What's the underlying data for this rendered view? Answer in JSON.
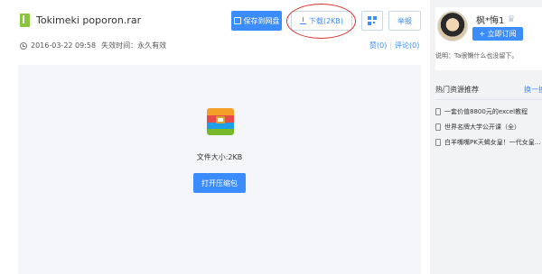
{
  "file": {
    "name": "Tokimeki poporon.rar",
    "date": "2016-03-22 09:58",
    "validity": "失效时间：永久有效",
    "size_text": "文件大小:2KB"
  },
  "actions": {
    "save_label": "保存到网盘",
    "download_label": "下载(2KB)",
    "report_label": "举报",
    "open_label": "打开压缩包"
  },
  "stats": {
    "like": "赞(0)",
    "comment": "评论(0)"
  },
  "user": {
    "name": "枫*悔1",
    "subscribe_label": "+ 立即订阅",
    "description": "说明：Ta很懒什么也没留下。"
  },
  "hot": {
    "title": "热门资源推荐",
    "more": "换一换",
    "items": [
      "一套价值8800元的excel教程",
      "世界名牌大学公开课（全）",
      "白羊嘴嘴PK天蝎女皇！一代女皇..."
    ]
  },
  "colors": {
    "accent": "#3b8cff",
    "annotation": "#d9302a"
  }
}
